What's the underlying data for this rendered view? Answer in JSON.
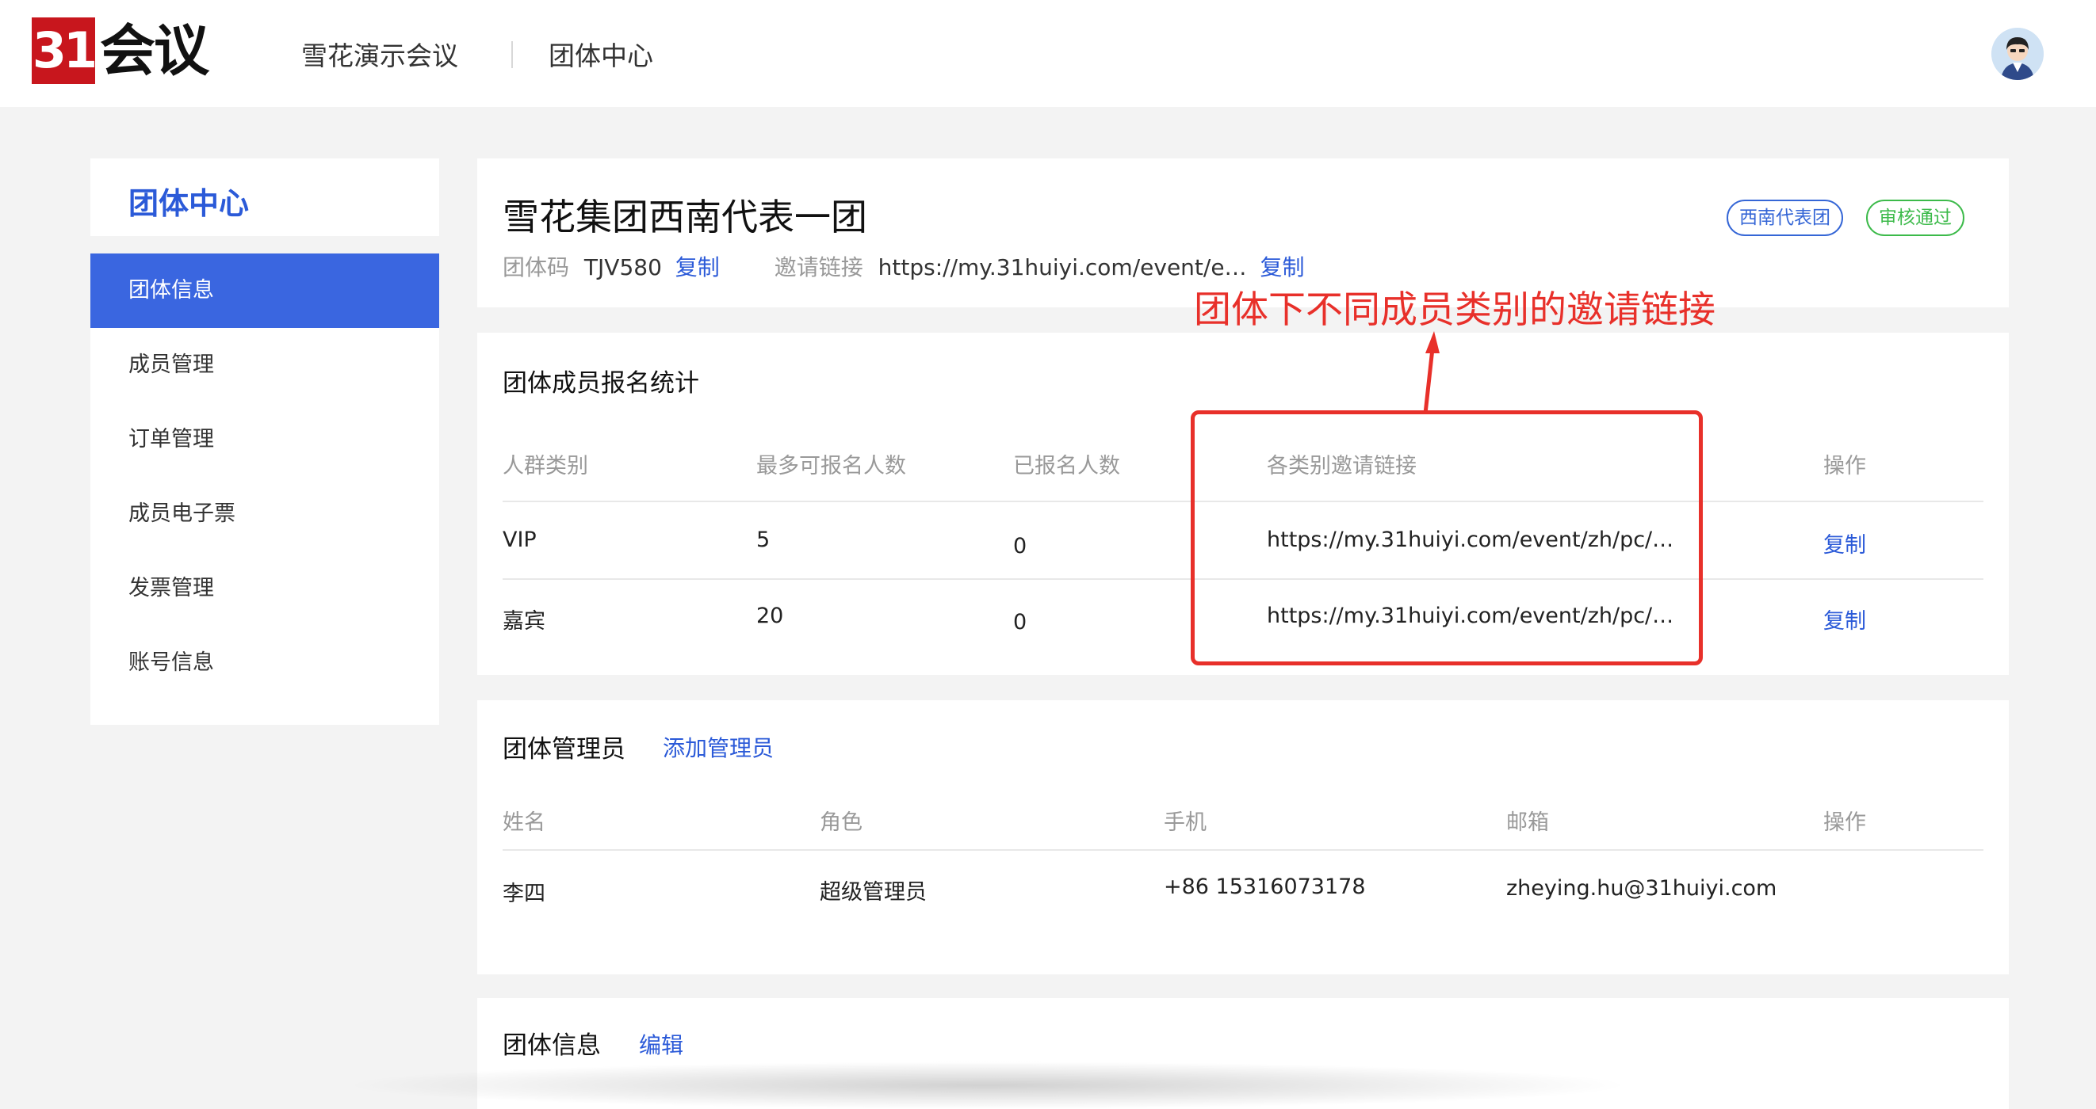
{
  "header": {
    "logo_number": "31",
    "logo_text": "会议",
    "event_name": "雪花演示会议",
    "section": "团体中心"
  },
  "sidebar": {
    "title": "团体中心",
    "items": [
      {
        "label": "团体信息",
        "active": true
      },
      {
        "label": "成员管理",
        "active": false
      },
      {
        "label": "订单管理",
        "active": false
      },
      {
        "label": "成员电子票",
        "active": false
      },
      {
        "label": "发票管理",
        "active": false
      },
      {
        "label": "账号信息",
        "active": false
      }
    ]
  },
  "group": {
    "name": "雪花集团西南代表一团",
    "code_label": "团体码",
    "code_value": "TJV580",
    "code_copy": "复制",
    "invite_label": "邀请链接",
    "invite_value": "https://my.31huiyi.com/event/e…",
    "invite_copy": "复制",
    "tags": [
      {
        "label": "西南代表团",
        "color": "#3566d6"
      },
      {
        "label": "审核通过",
        "color": "#3cba4a"
      }
    ]
  },
  "stats": {
    "title": "团体成员报名统计",
    "columns": [
      "人群类别",
      "最多可报名人数",
      "已报名人数",
      "各类别邀请链接",
      "操作"
    ],
    "rows": [
      {
        "category": "VIP",
        "max": "5",
        "registered": "0",
        "link": "https://my.31huiyi.com/event/zh/pc/…",
        "action": "复制"
      },
      {
        "category": "嘉宾",
        "max": "20",
        "registered": "0",
        "link": "https://my.31huiyi.com/event/zh/pc/…",
        "action": "复制"
      }
    ]
  },
  "annotation": {
    "text": "团体下不同成员类别的邀请链接",
    "color": "#e8302a"
  },
  "admins": {
    "title": "团体管理员",
    "add_label": "添加管理员",
    "columns": [
      "姓名",
      "角色",
      "手机",
      "邮箱",
      "操作"
    ],
    "rows": [
      {
        "name": "李四",
        "role": "超级管理员",
        "phone": "+86 15316073178",
        "email": "zheying.hu@31huiyi.com"
      }
    ]
  },
  "info": {
    "title": "团体信息",
    "edit_label": "编辑"
  },
  "colors": {
    "primary": "#3a66e0",
    "link": "#2b5ad8",
    "logo_red": "#c8161d"
  }
}
